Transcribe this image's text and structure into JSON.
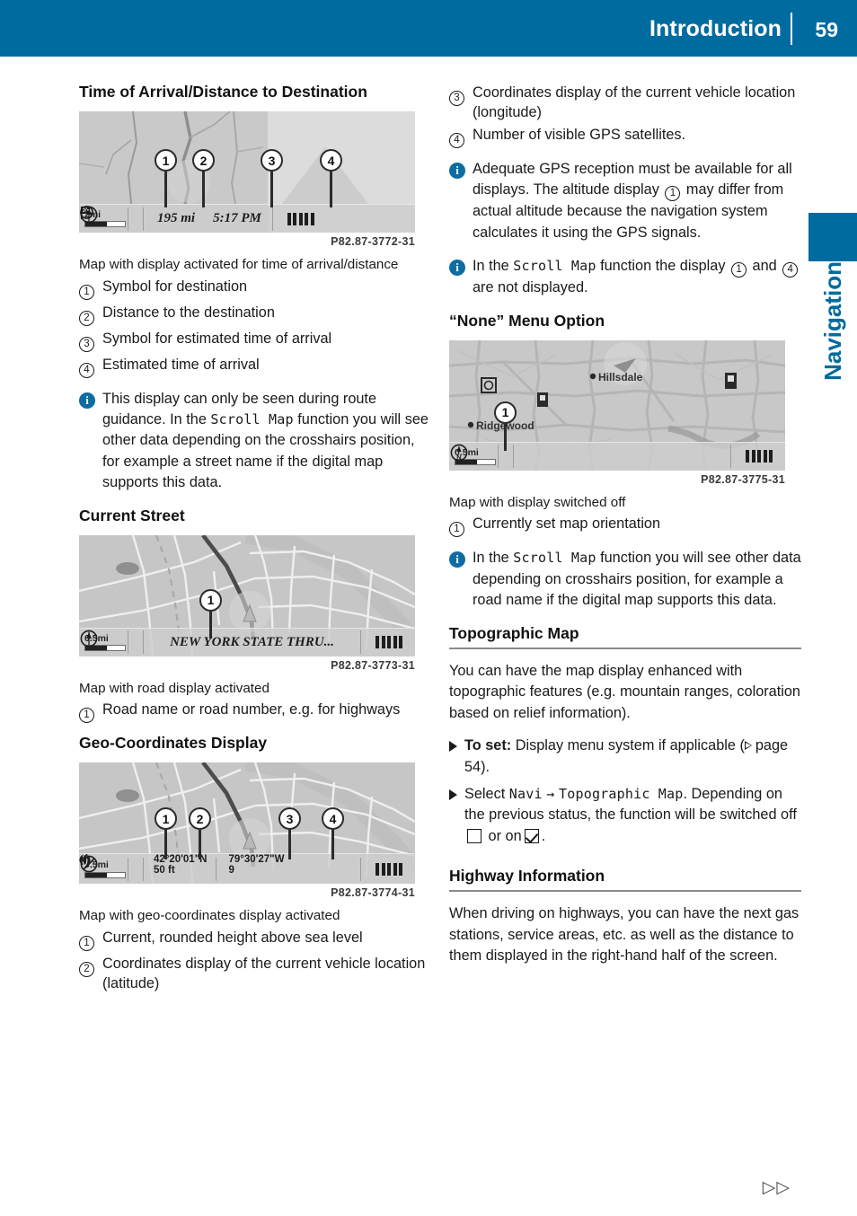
{
  "header": {
    "title": "Introduction",
    "page_number": "59"
  },
  "side_tab": {
    "label": "Navigation"
  },
  "colors": {
    "accent_blue": "#006b9e",
    "info_icon_blue": "#0e6ca0",
    "rule_gray": "#8a8a8a"
  },
  "left_column": {
    "section1": {
      "heading": "Time of Arrival/Distance to Destination",
      "figure": {
        "code": "P82.87-3772-31",
        "scale": "2mi",
        "distance": "195 mi",
        "time": "5:17 PM"
      },
      "caption": "Map with display activated for time of arrival/distance",
      "legend": [
        {
          "num": "1",
          "text": "Symbol for destination"
        },
        {
          "num": "2",
          "text": "Distance to the destination"
        },
        {
          "num": "3",
          "text": "Symbol for estimated time of arrival"
        },
        {
          "num": "4",
          "text": "Estimated time of arrival"
        }
      ],
      "note": {
        "part1": "This display can only be seen during route guidance. In the ",
        "mono": "Scroll Map",
        "part2": " function you will see other data depending on the crosshairs position, for example a street name if the digital map supports this data."
      }
    },
    "section2": {
      "heading": "Current Street",
      "figure": {
        "code": "P82.87-3773-31",
        "scale": "0.5mi",
        "street": "NEW YORK STATE THRU..."
      },
      "caption": "Map with road display activated",
      "legend": [
        {
          "num": "1",
          "text": "Road name or road number, e.g. for highways"
        }
      ]
    },
    "section3": {
      "heading": "Geo-Coordinates Display",
      "figure": {
        "code": "P82.87-3774-31",
        "scale": "0.5mi",
        "latitude": "42°20'01\"N",
        "altitude": "50 ft",
        "longitude": "79°30'27\"W",
        "satellites": "9"
      },
      "caption": "Map with geo-coordinates display activated",
      "legend": [
        {
          "num": "1",
          "text": "Current, rounded height above sea level"
        },
        {
          "num": "2",
          "text": "Coordinates display of the current vehicle location (latitude)"
        }
      ]
    }
  },
  "right_column": {
    "legend_continued": [
      {
        "num": "3",
        "text": "Coordinates display of the current vehicle location (longitude)"
      },
      {
        "num": "4",
        "text": "Number of visible GPS satellites."
      }
    ],
    "note_gps": {
      "part1": "Adequate GPS reception must be available for all displays. The altitude display ",
      "circled": "1",
      "part2": " may differ from actual altitude because the navigation system calculates it using the GPS signals."
    },
    "note_scroll": {
      "part1": "In the ",
      "mono": "Scroll Map",
      "part2": " function the display ",
      "circled1": "1",
      "part3": " and ",
      "circled2": "4",
      "part4": " are not displayed."
    },
    "section_none": {
      "heading": "“None” Menu Option",
      "figure": {
        "code": "P82.87-3775-31",
        "scale": "0.5mi",
        "place1": "Hillsdale",
        "place2": "Ridgewood",
        "orientation": "N"
      },
      "caption": "Map with display switched off",
      "legend": [
        {
          "num": "1",
          "text": "Currently set map orientation"
        }
      ],
      "note": {
        "part1": "In the ",
        "mono": "Scroll Map",
        "part2": " function you will see other data depending on crosshairs position, for example a road name if the digital map supports this data."
      }
    },
    "section_topo": {
      "heading": "Topographic Map",
      "body": "You can have the map display enhanced with topographic features (e.g. mountain ranges, coloration based on relief information).",
      "action1": {
        "bold": "To set:",
        "text": " Display menu system if applicable (",
        "page_ref": "page 54",
        "tail": ")."
      },
      "action2": {
        "lead": "Select ",
        "mono1": "Navi",
        "arrow": "→",
        "mono2": "Topographic Map",
        "period": ".",
        "tail": "Depending on the previous status, the function will be switched off",
        "mid": "or on",
        "end": "."
      }
    },
    "section_highway": {
      "heading": "Highway Information",
      "body": "When driving on highways, you can have the next gas stations, service areas, etc. as well as the distance to them displayed in the right-hand half of the screen."
    }
  },
  "footer": {
    "nav_arrows": "▷▷"
  }
}
